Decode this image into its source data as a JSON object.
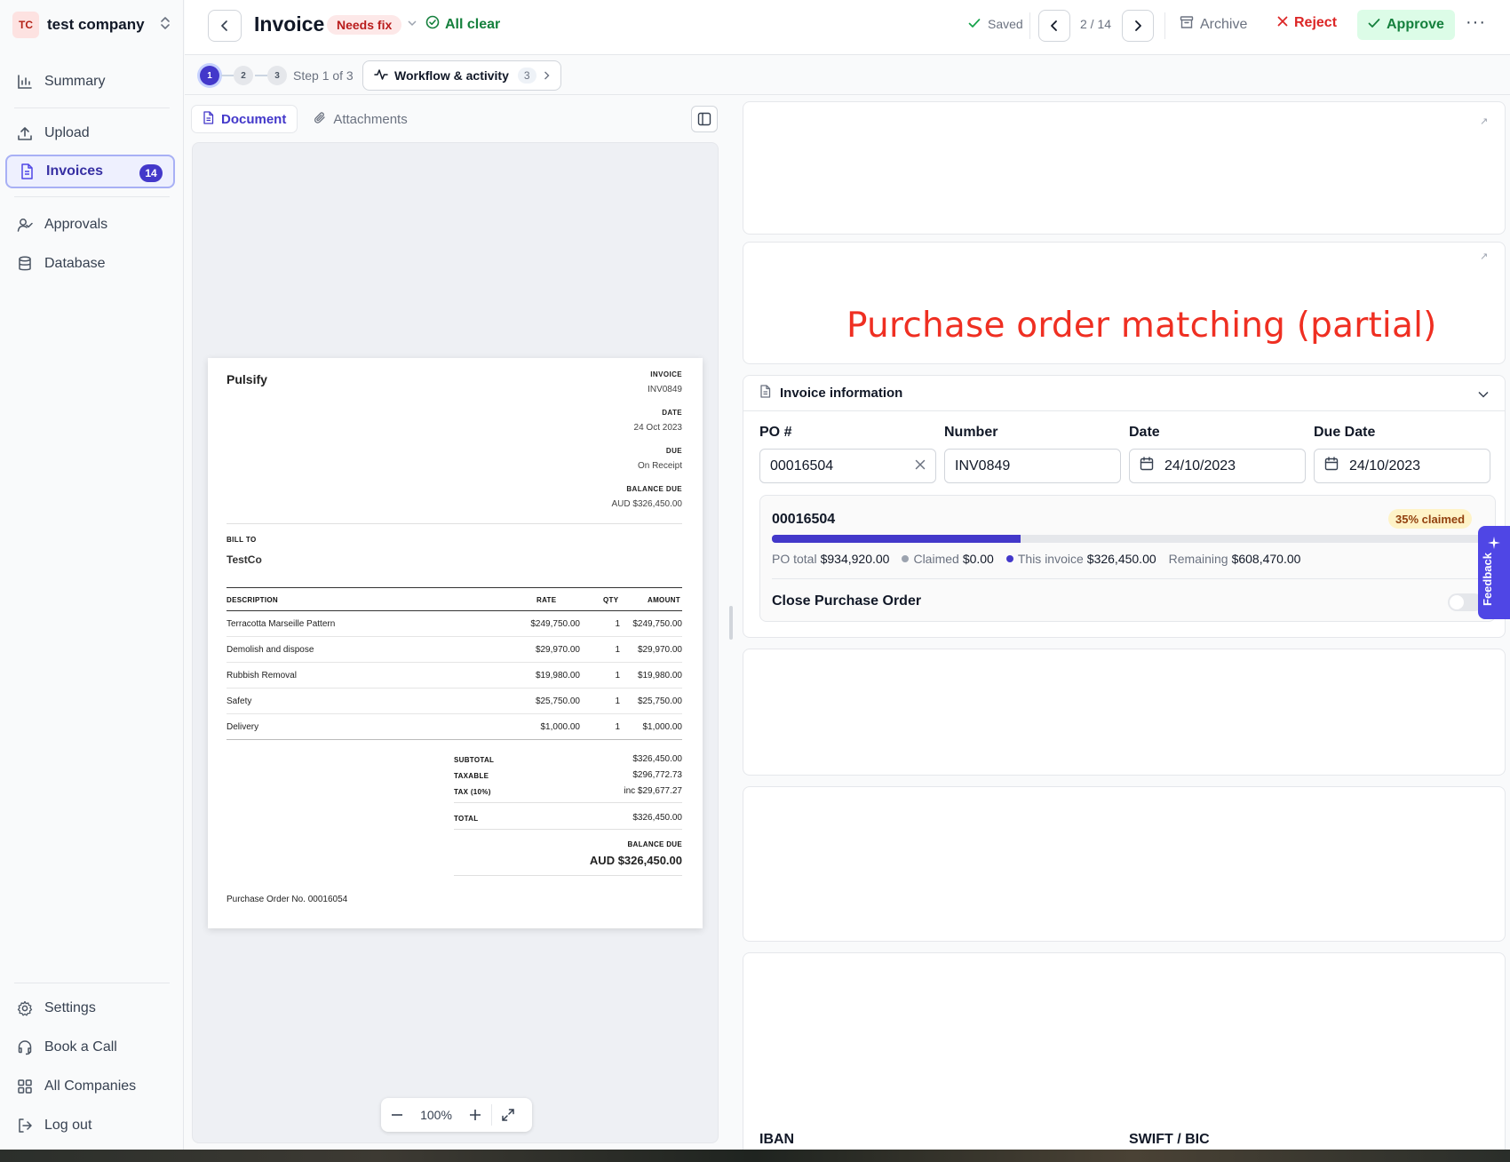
{
  "sidebar": {
    "company": {
      "initials": "TC",
      "name": "test company"
    },
    "items": [
      {
        "label": "Summary",
        "icon": "bar-chart-icon"
      },
      {
        "label": "Upload",
        "icon": "upload-icon"
      },
      {
        "label": "Invoices",
        "icon": "file-icon",
        "badge": "14",
        "active": true
      },
      {
        "label": "Approvals",
        "icon": "user-check-icon"
      },
      {
        "label": "Database",
        "icon": "database-icon"
      }
    ],
    "bottom_items": [
      {
        "label": "Settings",
        "icon": "gear-icon"
      },
      {
        "label": "Book a Call",
        "icon": "headset-icon"
      },
      {
        "label": "All Companies",
        "icon": "grid-icon"
      },
      {
        "label": "Log out",
        "icon": "logout-icon"
      }
    ]
  },
  "header": {
    "title": "Invoice",
    "status": "Needs fix",
    "check_status": "All clear",
    "saved": "Saved",
    "pager": "2 / 14",
    "archive": "Archive",
    "reject": "Reject",
    "approve": "Approve"
  },
  "steps": {
    "numbers": [
      "1",
      "2",
      "3"
    ],
    "label": "Step 1 of 3",
    "workflow_label": "Workflow & activity",
    "workflow_count": "3"
  },
  "document": {
    "tabs": [
      "Document",
      "Attachments"
    ],
    "zoom": "100%"
  },
  "invoice_doc": {
    "brand": "Pulsify",
    "invoice_label": "INVOICE",
    "invoice_no": "INV0849",
    "date_label": "DATE",
    "date": "24 Oct 2023",
    "due_label": "DUE",
    "due": "On Receipt",
    "balance_label": "BALANCE DUE",
    "balance": "AUD $326,450.00",
    "bill_to_label": "BILL TO",
    "bill_to": "TestCo",
    "columns": [
      "DESCRIPTION",
      "RATE",
      "QTY",
      "AMOUNT"
    ],
    "lines": [
      {
        "desc": "Terracotta Marseille Pattern",
        "rate": "$249,750.00",
        "qty": "1",
        "amount": "$249,750.00"
      },
      {
        "desc": "Demolish and dispose",
        "rate": "$29,970.00",
        "qty": "1",
        "amount": "$29,970.00"
      },
      {
        "desc": "Rubbish Removal",
        "rate": "$19,980.00",
        "qty": "1",
        "amount": "$19,980.00"
      },
      {
        "desc": "Safety",
        "rate": "$25,750.00",
        "qty": "1",
        "amount": "$25,750.00"
      },
      {
        "desc": "Delivery",
        "rate": "$1,000.00",
        "qty": "1",
        "amount": "$1,000.00"
      }
    ],
    "subtotal_label": "SUBTOTAL",
    "subtotal": "$326,450.00",
    "taxable_label": "TAXABLE",
    "taxable": "$296,772.73",
    "tax_label": "TAX (10%)",
    "tax": "inc $29,677.27",
    "total_label": "TOTAL",
    "total": "$326,450.00",
    "balance_due_label": "BALANCE DUE",
    "balance_due": "AUD $326,450.00",
    "po_note": "Purchase Order No. 00016054"
  },
  "overlay_title": "Purchase order matching (partial)",
  "invoice_info": {
    "heading": "Invoice information",
    "po_label": "PO #",
    "po_value": "00016504",
    "number_label": "Number",
    "number_value": "INV0849",
    "date_label": "Date",
    "date_value": "24/10/2023",
    "due_label": "Due Date",
    "due_value": "24/10/2023"
  },
  "po_summary": {
    "po_number": "00016504",
    "claimed_badge": "35% claimed",
    "progress_fraction": 0.35,
    "po_total_label": "PO total",
    "po_total": "$934,920.00",
    "claimed_label": "Claimed",
    "claimed": "$0.00",
    "this_invoice_label": "This invoice",
    "this_invoice": "$326,450.00",
    "remaining_label": "Remaining",
    "remaining": "$608,470.00",
    "close_label": "Close Purchase Order"
  },
  "feedback": "Feedback",
  "bank": {
    "iban_label": "IBAN",
    "swift_label": "SWIFT / BIC"
  },
  "colors": {
    "accent": "#4338ca",
    "danger": "#dc2626",
    "success": "#15803d",
    "overlay_text": "#ef2f22"
  }
}
